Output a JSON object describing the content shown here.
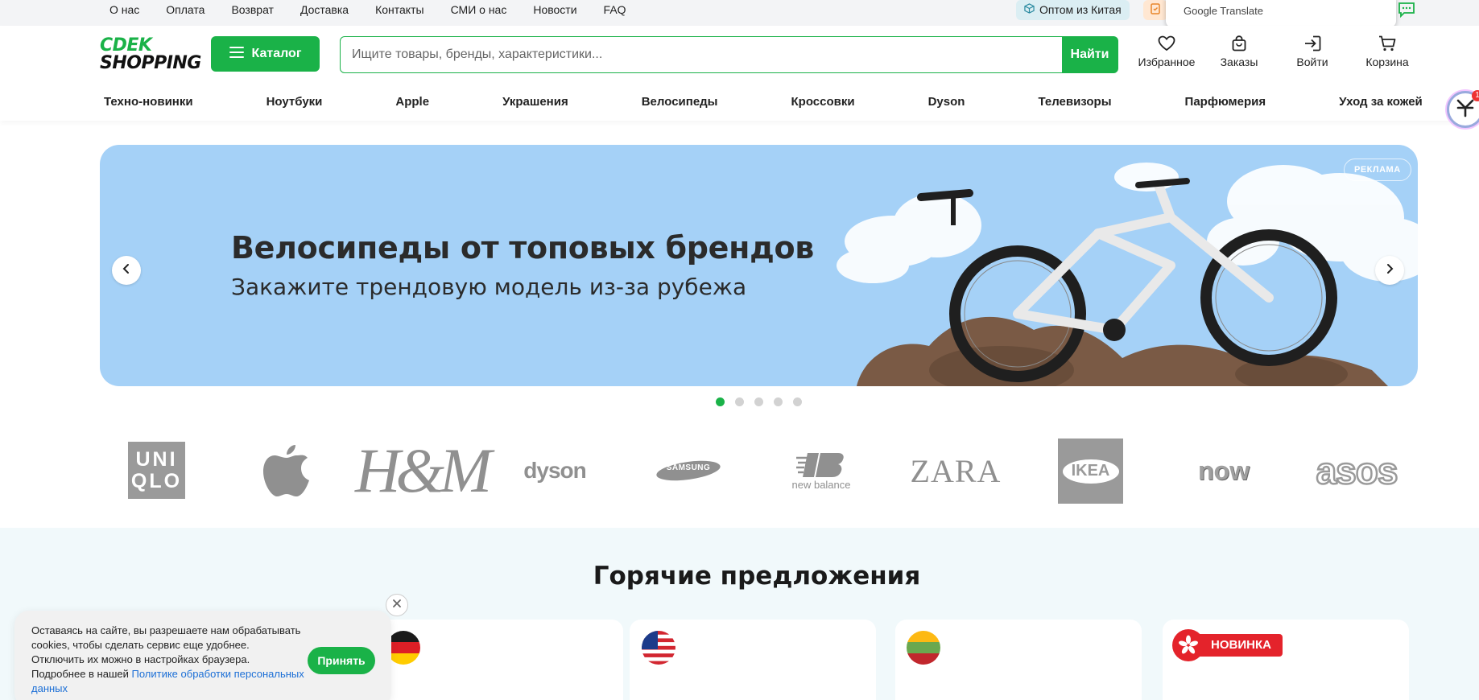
{
  "topbar": {
    "links": [
      "О нас",
      "Оплата",
      "Возврат",
      "Доставка",
      "Контакты",
      "СМИ о нас",
      "Новости",
      "FAQ"
    ],
    "china_label": "Оптом из Китая",
    "translate_label": "Google Translate"
  },
  "header": {
    "logo_line1": "CDEK",
    "logo_line2": "SHOPPING",
    "catalog_label": "Каталог",
    "search_placeholder": "Ищите товары, бренды, характеристики...",
    "search_button": "Найти",
    "favorites": "Избранное",
    "orders": "Заказы",
    "login": "Войти",
    "cart": "Корзина"
  },
  "categories": [
    "Техно-новинки",
    "Ноутбуки",
    "Apple",
    "Украшения",
    "Велосипеды",
    "Кроссовки",
    "Dyson",
    "Телевизоры",
    "Парфюмерия",
    "Уход за кожей"
  ],
  "side_badge_count": "1",
  "banner": {
    "title": "Велосипеды от топовых брендов",
    "subtitle": "Закажите трендовую модель из-за рубежа",
    "ad_label": "РЕКЛАМА",
    "slide_count": 5,
    "active_slide": 1
  },
  "brands": {
    "uniqlo_l1": "UNI",
    "uniqlo_l2": "QLO",
    "hm": "H&M",
    "dyson": "dyson",
    "samsung": "SAMSUNG",
    "newbalance": "new balance",
    "zara": "ZARA",
    "ikea": "IKEA",
    "now": "now",
    "asos": "asos"
  },
  "hot_offers": {
    "title": "Горячие предложения",
    "new_badge": "НОВИНКА"
  },
  "cookie": {
    "text": "Оставаясь на сайте, вы разрешаете нам обрабатывать cookies, чтобы сделать сервис еще удобнее. Отключить их можно в настройках браузера. Подробнее в нашей ",
    "link": "Политике обработки персональных данных",
    "accept": "Принять"
  },
  "colors": {
    "brand_green": "#1ab248",
    "banner_bg": "#a5d1f7",
    "hot_bg": "#f1f9fb",
    "badge_red": "#e4232b"
  }
}
